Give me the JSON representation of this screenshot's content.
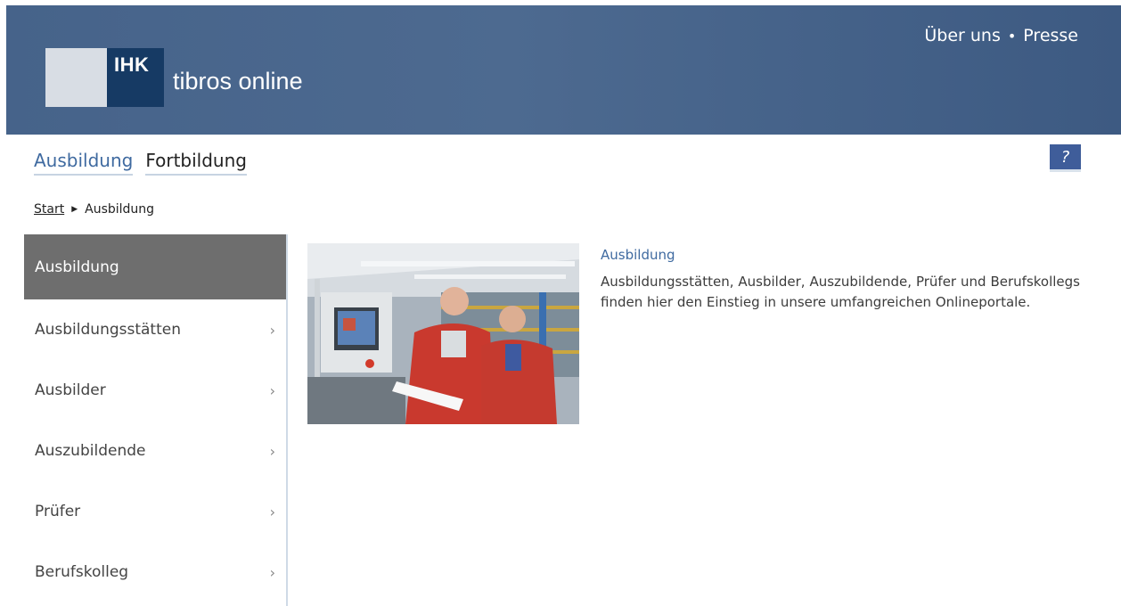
{
  "header": {
    "logo_text": "IHK",
    "app_title": "tibros online",
    "links": [
      "Über uns",
      "Presse"
    ],
    "separator": "•"
  },
  "tabs": [
    {
      "label": "Ausbildung",
      "active": true
    },
    {
      "label": "Fortbildung",
      "active": false
    }
  ],
  "help": {
    "label": "?"
  },
  "breadcrumb": {
    "start": "Start",
    "current": "Ausbildung"
  },
  "sidebar": {
    "items": [
      {
        "label": "Ausbildung",
        "active": true
      },
      {
        "label": "Ausbildungsstätten",
        "chevron": "›"
      },
      {
        "label": "Ausbilder",
        "chevron": "›"
      },
      {
        "label": "Auszubildende",
        "chevron": "›"
      },
      {
        "label": "Prüfer",
        "chevron": "›"
      },
      {
        "label": "Berufskolleg",
        "chevron": "›"
      }
    ]
  },
  "content": {
    "title": "Ausbildung",
    "text": "Ausbildungsstätten, Ausbilder, Auszubildende, Prüfer und Berufskollegs finden hier den Einstieg in unsere umfangreichen Onlineportale."
  },
  "colors": {
    "header_bg": "#4d6a90",
    "accent": "#3f6aa0",
    "sidebar_active": "#6e6e6e",
    "logo_dark": "#163a64"
  }
}
